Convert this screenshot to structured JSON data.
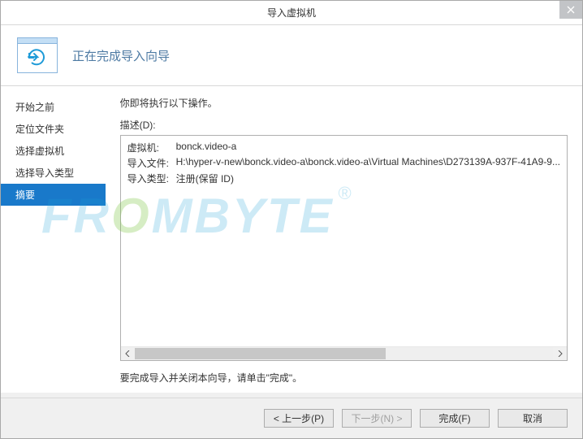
{
  "window": {
    "title": "导入虚拟机"
  },
  "header": {
    "title": "正在完成导入向导"
  },
  "sidebar": {
    "items": [
      {
        "label": "开始之前"
      },
      {
        "label": "定位文件夹"
      },
      {
        "label": "选择虚拟机"
      },
      {
        "label": "选择导入类型"
      },
      {
        "label": "摘要"
      }
    ],
    "active_index": 4
  },
  "main": {
    "intro": "你即将执行以下操作。",
    "desc_label": "描述(D):",
    "rows": [
      {
        "label": "虚拟机:",
        "value": "bonck.video-a"
      },
      {
        "label": "导入文件:",
        "value": "H:\\hyper-v-new\\bonck.video-a\\bonck.video-a\\Virtual Machines\\D273139A-937F-41A9-9..."
      },
      {
        "label": "导入类型:",
        "value": "注册(保留 ID)"
      }
    ],
    "finish_text": "要完成导入并关闭本向导，请单击\"完成\"。"
  },
  "footer": {
    "prev": "< 上一步(P)",
    "next": "下一步(N) >",
    "finish": "完成(F)",
    "cancel": "取消"
  },
  "watermark": "FROMBYTE"
}
